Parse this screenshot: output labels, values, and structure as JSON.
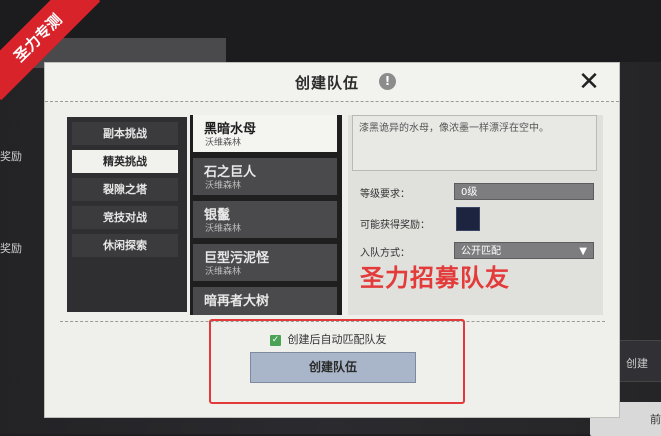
{
  "dialog": {
    "title": "创建队伍",
    "info_icon": "!",
    "close_icon": "✕"
  },
  "categories": [
    {
      "label": "副本挑战",
      "active": false
    },
    {
      "label": "精英挑战",
      "active": true
    },
    {
      "label": "裂隙之塔",
      "active": false
    },
    {
      "label": "竞技对战",
      "active": false
    },
    {
      "label": "休闲探索",
      "active": false
    }
  ],
  "dungeons": [
    {
      "name": "黑暗水母",
      "region": "沃维森林",
      "active": true
    },
    {
      "name": "石之巨人",
      "region": "沃维森林",
      "active": false
    },
    {
      "name": "银鬣",
      "region": "沃维森林",
      "active": false
    },
    {
      "name": "巨型污泥怪",
      "region": "沃维森林",
      "active": false
    },
    {
      "name": "暗再者大树",
      "region": "",
      "active": false
    }
  ],
  "details": {
    "description": "漆黑诡异的水母，像浓墨一样漂浮在空中。",
    "level_label": "等级要求：",
    "level_value": "0级",
    "reward_label": "可能获得奖励：",
    "join_label": "入队方式：",
    "join_value": "公开匹配"
  },
  "footer": {
    "auto_match_label": "创建后自动匹配队友",
    "auto_match_checked": true,
    "create_button": "创建队伍"
  },
  "overlay": {
    "recruit_text": "圣力招募队友",
    "watermark": "圣力专测"
  },
  "background": {
    "left_text_1": "奖励",
    "left_text_2": "奖励",
    "right_text_1": "创建",
    "right_text_2": "前"
  },
  "colors": {
    "highlight": "#e23a3a",
    "check": "#4ba255",
    "button": "#a9b5c8"
  }
}
